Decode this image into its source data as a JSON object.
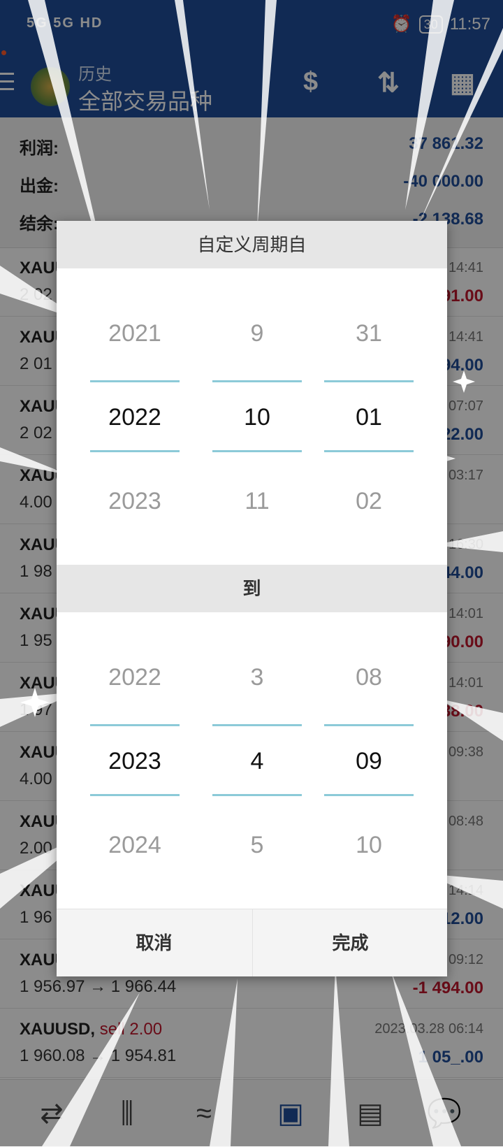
{
  "status_bar": {
    "signal_left": "5G 5G HD",
    "battery": "30",
    "time": "11:57"
  },
  "app_bar": {
    "subtitle": "历史",
    "title": "全部交易品种"
  },
  "summary": [
    {
      "label": "利润:",
      "value": "37 861.32"
    },
    {
      "label": "出金:",
      "value": "-40 000.00"
    },
    {
      "label": "结余:",
      "value": "-2 138.68"
    }
  ],
  "trades": [
    {
      "symbol": "XAUUSD,",
      "side": "",
      "price": "2 02",
      "time": "14:41",
      "profit": "91.00",
      "sign": "neg"
    },
    {
      "symbol": "XAUUSD,",
      "side": "",
      "price": "2 01",
      "time": "14:41",
      "profit": "94.00",
      "sign": "pos"
    },
    {
      "symbol": "XAUUSD,",
      "side": "",
      "price": "2 02",
      "time": "07:07",
      "profit": "22.00",
      "sign": "pos"
    },
    {
      "symbol": "XAUUSD,",
      "side": "",
      "price": "4.00",
      "time": "03:17",
      "profit": "",
      "sign": "pos"
    },
    {
      "symbol": "XAUUSD,",
      "side": "",
      "price": "1 98",
      "time": "16:30",
      "profit": "44.00",
      "sign": "pos"
    },
    {
      "symbol": "XAUUSD,",
      "side": "",
      "price": "1 95",
      "time": "14:01",
      "profit": "90.00",
      "sign": "neg"
    },
    {
      "symbol": "XAUUSD,",
      "side": "",
      "price": "1 97",
      "time": "14:01",
      "profit": "38.00",
      "sign": "neg"
    },
    {
      "symbol": "XAUUSD,",
      "side": "",
      "price": "4.00",
      "time": "09:38",
      "profit": "",
      "sign": "pos"
    },
    {
      "symbol": "XAUUSD,",
      "side": "",
      "price": "2.00",
      "time": "08:48",
      "profit": "",
      "sign": "pos"
    },
    {
      "symbol": "XAUUSD,",
      "side": "",
      "price": "1 96",
      "time": "14:14",
      "profit": "12.00",
      "sign": "pos"
    },
    {
      "symbol": "XAUUSD,",
      "side": "",
      "price": "1 956.97 → 1 966.44",
      "time": "09:12",
      "profit": "-1 494.00",
      "sign": "neg"
    },
    {
      "symbol": "XAUUSD,",
      "side": "sell 2.00",
      "price": "1 960.08 → 1 954.81",
      "time": "2023.03.28 06:14",
      "profit": "1 05_.00",
      "sign": "pos"
    }
  ],
  "dialog": {
    "title": "自定义周期自",
    "separator": "到",
    "from": {
      "year": [
        "2021",
        "2022",
        "2023"
      ],
      "month": [
        "9",
        "10",
        "11"
      ],
      "day": [
        "31",
        "01",
        "02"
      ]
    },
    "to": {
      "year": [
        "2022",
        "2023",
        "2024"
      ],
      "month": [
        "3",
        "4",
        "5"
      ],
      "day": [
        "08",
        "09",
        "10"
      ]
    },
    "cancel": "取消",
    "done": "完成"
  },
  "bottom_nav": [
    {
      "icon": "quotes-icon",
      "glyph": "⇄"
    },
    {
      "icon": "chart-icon",
      "glyph": "⫼"
    },
    {
      "icon": "trade-icon",
      "glyph": "≈"
    },
    {
      "icon": "history-icon",
      "glyph": "▣"
    },
    {
      "icon": "news-icon",
      "glyph": "▤"
    },
    {
      "icon": "chat-icon",
      "glyph": "💬"
    }
  ],
  "colors": {
    "primary": "#1f4e9a",
    "negative": "#c0162c",
    "picker_line": "#8ccad8"
  }
}
